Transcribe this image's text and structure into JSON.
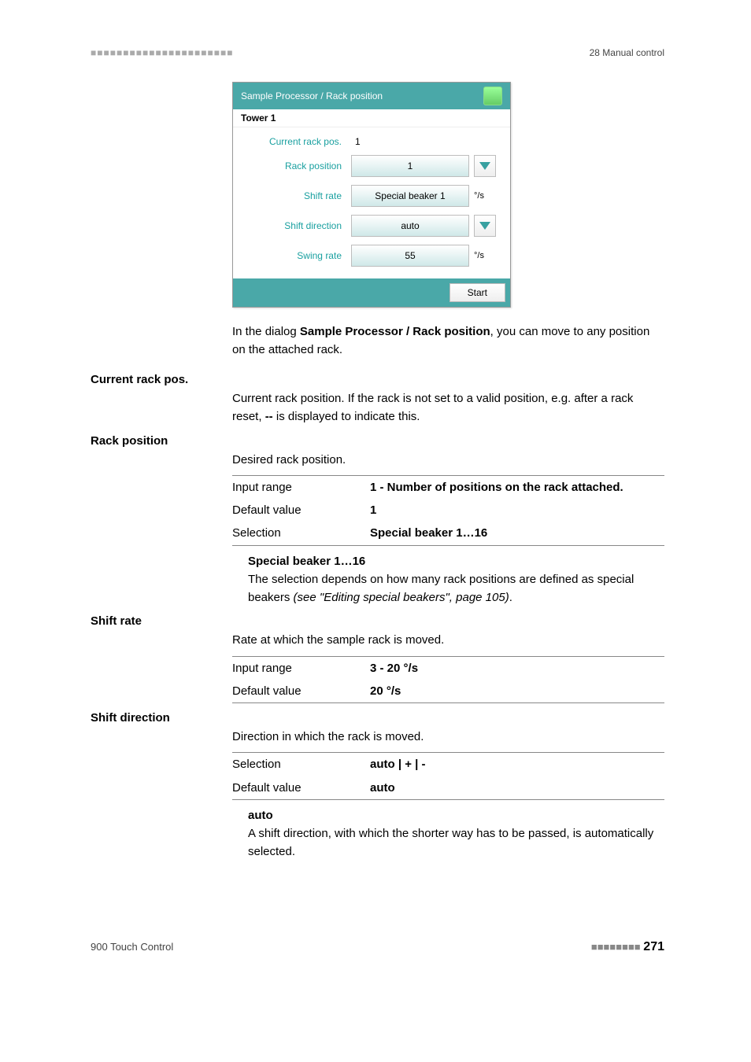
{
  "header": {
    "left": "■■■■■■■■■■■■■■■■■■■■■■",
    "right": "28 Manual control"
  },
  "dialog": {
    "title": "Sample Processor / Rack position",
    "subtitle": "Tower 1",
    "rows": {
      "current_label": "Current rack pos.",
      "current_value": "1",
      "rackpos_label": "Rack position",
      "rackpos_value": "1",
      "shiftrate_label": "Shift rate",
      "shiftrate_value": "Special beaker 1",
      "shiftrate_unit": "°/s",
      "shiftdir_label": "Shift direction",
      "shiftdir_value": "auto",
      "swing_label": "Swing rate",
      "swing_value": "55",
      "swing_unit": "°/s"
    },
    "start": "Start"
  },
  "intro": {
    "p1a": "In the dialog ",
    "p1b": "Sample Processor / Rack position",
    "p1c": ", you can move to any position on the attached rack."
  },
  "sections": {
    "current": {
      "heading": "Current rack pos.",
      "p1": "Current rack position. If the rack is not set to a valid position, e.g. after a rack reset, ",
      "p2": "--",
      "p3": " is displayed to indicate this."
    },
    "rackpos": {
      "heading": "Rack position",
      "desc": "Desired rack position.",
      "r1k": "Input range",
      "r1v": "1 - Number of positions on the rack attached.",
      "r2k": "Default value",
      "r2v": "1",
      "r3k": "Selection",
      "r3v": "Special beaker 1…16",
      "sub_h": "Special beaker 1…16",
      "sub_p1": "The selection depends on how many rack positions are defined as special beakers ",
      "sub_p2": "(see \"Editing special beakers\", page 105)",
      "sub_p3": "."
    },
    "shiftrate": {
      "heading": "Shift rate",
      "desc": "Rate at which the sample rack is moved.",
      "r1k": "Input range",
      "r1v": "3 - 20 °/s",
      "r2k": "Default value",
      "r2v": "20 °/s"
    },
    "shiftdir": {
      "heading": "Shift direction",
      "desc": "Direction in which the rack is moved.",
      "r1k": "Selection",
      "r1v": "auto | + | -",
      "r2k": "Default value",
      "r2v": "auto",
      "sub_h": "auto",
      "sub_p": "A shift direction, with which the shorter way has to be passed, is automatically selected."
    }
  },
  "footer": {
    "left": "900 Touch Control",
    "dots": "■■■■■■■■",
    "page": "271"
  }
}
